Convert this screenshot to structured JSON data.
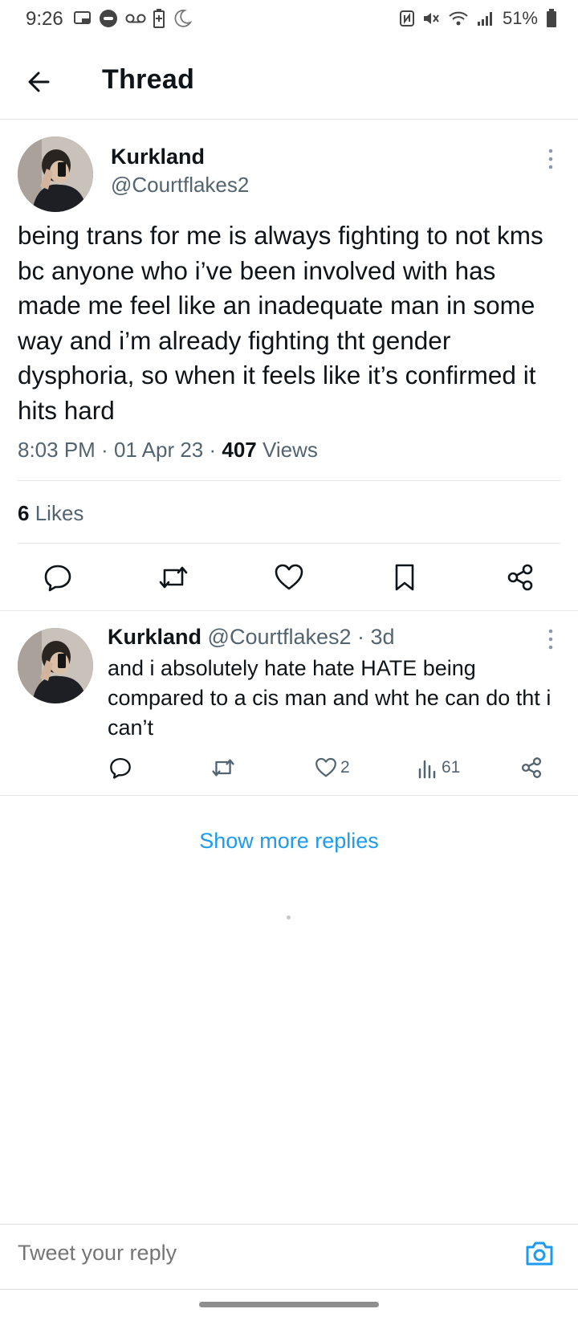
{
  "status_bar": {
    "time": "9:26",
    "battery": "51%"
  },
  "header": {
    "title": "Thread"
  },
  "main_tweet": {
    "name": "Kurkland",
    "handle": "@Courtflakes2",
    "text": "being trans for me is always fighting to not kms bc anyone who i’ve been involved with has made me feel like an inadequate man in some way and i’m already fighting tht gender dysphoria, so when it feels like it’s confirmed it hits hard",
    "time": "8:03 PM",
    "date": "01 Apr 23",
    "views_count": "407",
    "views_label": "Views",
    "likes_count": "6",
    "likes_label": "Likes"
  },
  "reply": {
    "name": "Kurkland",
    "handle": "@Courtflakes2",
    "age": "3d",
    "text": "and i absolutely hate hate HATE being compared to a cis man and wht he can do tht i can’t",
    "like_count": "2",
    "view_count": "61"
  },
  "show_more_label": "Show more replies",
  "composer": {
    "placeholder": "Tweet your reply"
  },
  "colors": {
    "accent": "#1d9bf0",
    "secondary_text": "#536471",
    "icon": "#0f1419"
  },
  "icons": [
    "back-arrow-icon",
    "more-vertical-icon",
    "reply-icon",
    "retweet-icon",
    "like-icon",
    "bookmark-icon",
    "share-icon",
    "views-icon",
    "camera-icon"
  ]
}
